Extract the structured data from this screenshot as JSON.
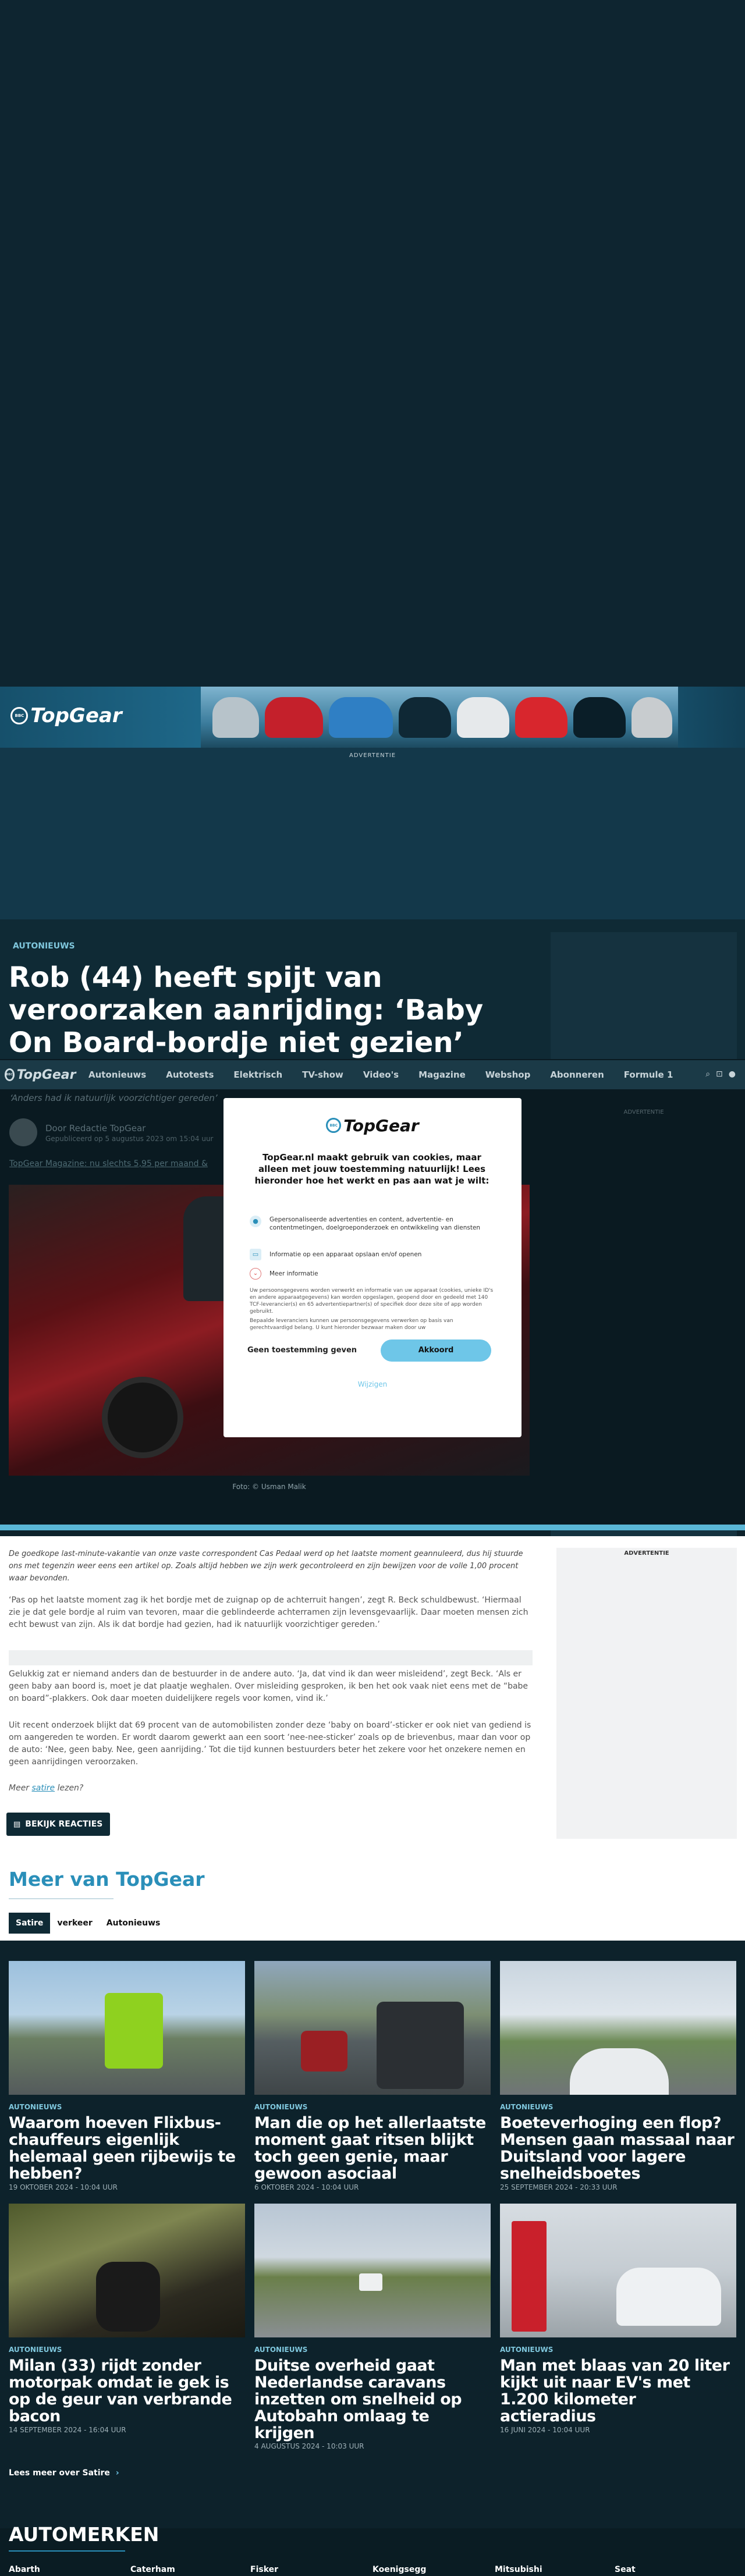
{
  "ad": {
    "label": "ADVERTENTIE",
    "banner_logo": "TopGear",
    "brand_color": "#13384a"
  },
  "nav": {
    "logo": "TopGear",
    "items": [
      "Autonieuws",
      "Autotests",
      "Elektrisch",
      "TV-show",
      "Video's",
      "Magazine",
      "Webshop",
      "Abonneren",
      "Formule 1"
    ],
    "icons": [
      "search-icon",
      "cart-icon",
      "user-icon"
    ]
  },
  "article": {
    "category": "AUTONIEUWS",
    "title": "Rob (44) heeft spijt van veroorzaken aanrijding: ‘Baby On Board-bordje niet gezien’",
    "subtitle": "‘Anders had ik natuurlijk voorzichtiger gereden’",
    "author": "Door Redactie TopGear",
    "published": "Gepubliceerd op 5 augustus 2023 om 15:04 uur",
    "promo_link": "TopGear Magazine: nu slechts 5,95 per maand &",
    "photo_credit": "Foto: © Usman Malik",
    "paragraphs": [
      "De goedkope last-minute-vakantie van onze vaste correspondent Cas Pedaal werd op het laatste moment geannuleerd, dus hij stuurde ons met tegenzin weer eens een artikel op. Zoals altijd hebben we zijn werk gecontroleerd en zijn bewijzen voor de volle 1,00 procent waar bevonden.",
      "‘Pas op het laatste moment zag ik het bordje met de zuignap op de achterruit hangen’, zegt R. Beck schuldbewust. ‘Hiermaal zie je dat gele bordje al ruim van tevoren, maar die geblindeerde achterramen zijn levensgevaarlijk. Daar moeten mensen zich echt bewust van zijn. Als ik dat bordje had gezien, had ik natuurlijk voorzichtiger gereden.’",
      "Gelukkig zat er niemand anders dan de bestuurder in de andere auto. ‘Ja, dat vind ik dan weer misleidend’, zegt Beck. ‘Als er geen baby aan boord is, moet je dat plaatje weghalen. Over misleiding gesproken, ik ben het ook vaak niet eens met de “babe on board”-plakkers. Ook daar moeten duidelijkere regels voor komen, vind ik.’",
      "Uit recent onderzoek blijkt dat 69 procent van de automobilisten zonder deze ‘baby on board’-sticker er ook niet van gediend is om aangereden te worden. Er wordt daarom gewerkt aan een soort ‘nee-nee-sticker’ zoals op de brievenbus, maar dan voor op de auto: ‘Nee, geen baby. Nee, geen aanrijding.’ Tot die tijd kunnen bestuurders beter het zekere voor het onzekere nemen en geen aanrijdingen veroorzaken."
    ],
    "more_prefix": "Meer",
    "more_link": "satire",
    "more_suffix": "lezen?",
    "comments_button": "BEKIJK REACTIES"
  },
  "sidebar": {
    "ad_label": "ADVERTENTIE",
    "ad_label_bottom": "ADVERTENTIE"
  },
  "cookie": {
    "logo": "TopGear",
    "title": "TopGear.nl maakt gebruik van cookies, maar alleen met jouw toestemming natuurlijk! Lees hieronder hoe het werkt en pas aan wat je wilt:",
    "items": [
      {
        "icon": "person-icon",
        "text": "Gepersonaliseerde advertenties en content, advertentie- en contentmetingen, doelgroeponderzoek en ontwikkeling van diensten"
      },
      {
        "icon": "device-icon",
        "text": "Informatie op een apparaat opslaan en/of openen"
      },
      {
        "icon": "chevron-down-icon",
        "text": "Meer informatie"
      }
    ],
    "body1": "Uw persoonsgegevens worden verwerkt en informatie van uw apparaat (cookies, unieke ID's en andere apparaatgegevens) kan worden opgeslagen, geopend door en gedeeld met 140 TCF-leverancier(s) en 65 advertentiepartner(s) of specifiek door deze site of app worden gebruikt.",
    "body2": "Bepaalde leveranciers kunnen uw persoonsgegevens verwerken op basis van gerechtvaardigd belang. U kunt hieronder bezwaar maken door uw",
    "decline": "Geen toestemming geven",
    "accept": "Akkoord",
    "manage": "Wijzigen"
  },
  "more": {
    "title": "Meer van TopGear",
    "tabs": [
      "Satire",
      "verkeer",
      "Autonieuws"
    ],
    "cards": [
      {
        "category": "AUTONIEUWS",
        "title": "Waarom hoeven Flixbus-chauffeurs eigenlijk helemaal geen rijbewijs te hebben?",
        "date": "19 OKTOBER 2024 - 10:04 uur"
      },
      {
        "category": "AUTONIEUWS",
        "title": "Man die op het allerlaatste moment gaat ritsen blijkt toch geen genie, maar gewoon asociaal",
        "date": "6 OKTOBER 2024 - 10:04 uur"
      },
      {
        "category": "AUTONIEUWS",
        "title": "Boeteverhoging een flop? Mensen gaan massaal naar Duitsland voor lagere snelheidsboetes",
        "date": "25 SEPTEMBER 2024 - 20:33 uur"
      },
      {
        "category": "AUTONIEUWS",
        "title": "Milan (33) rijdt zonder motorpak omdat ie gek is op de geur van verbrande bacon",
        "date": "14 SEPTEMBER 2024 - 16:04 uur"
      },
      {
        "category": "AUTONIEUWS",
        "title": "Duitse overheid gaat Nederlandse caravans inzetten om snelheid op Autobahn omlaag te krijgen",
        "date": "4 AUGUSTUS 2024 - 10:03 uur"
      },
      {
        "category": "AUTONIEUWS",
        "title": "Man met blaas van 20 liter kijkt uit naar EV's met 1.200 kilometer actieradius",
        "date": "16 JUNI 2024 - 10:04 uur"
      }
    ],
    "read_more": "Lees meer over Satire"
  },
  "brands": {
    "title": "AUTOMERKEN",
    "items": [
      "Abarth",
      "Caterham",
      "Fisker",
      "Koenigsegg",
      "Mitsubishi",
      "Seat"
    ]
  },
  "colors": {
    "accent": "#6ec6e8",
    "bg": "#0d222b",
    "band": "#5ab6d6"
  }
}
